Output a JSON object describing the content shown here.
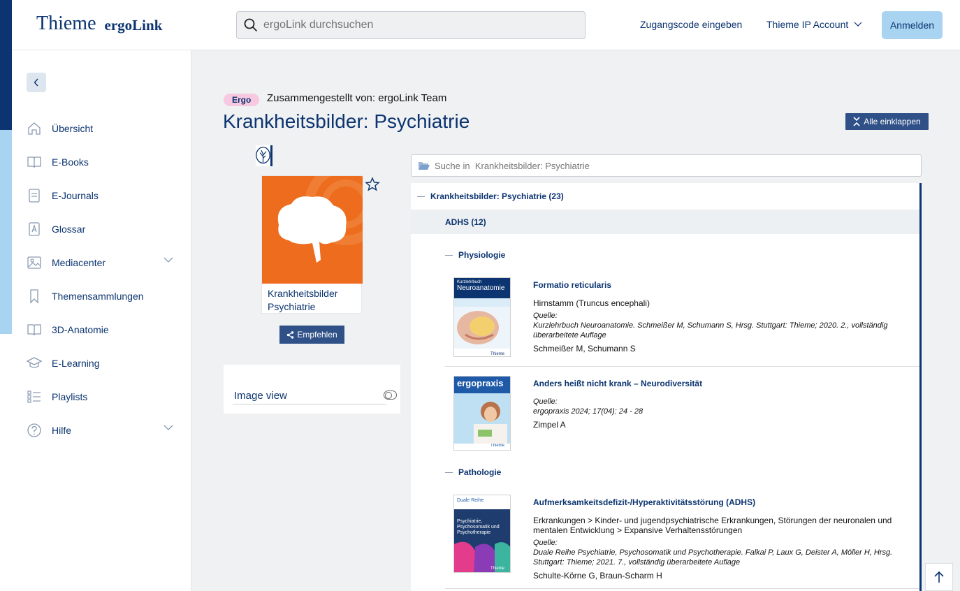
{
  "header": {
    "brand": "Thieme",
    "product": "ergoLink",
    "search_placeholder": "ergoLink durchsuchen",
    "access_code": "Zugangscode eingeben",
    "ip_account": "Thieme IP Account",
    "login": "Anmelden"
  },
  "sidebar": {
    "items": [
      {
        "label": "Übersicht",
        "icon": "home-icon"
      },
      {
        "label": "E-Books",
        "icon": "book-icon"
      },
      {
        "label": "E-Journals",
        "icon": "journal-icon"
      },
      {
        "label": "Glossar",
        "icon": "glossary-icon"
      },
      {
        "label": "Mediacenter",
        "icon": "image-icon",
        "expandable": true
      },
      {
        "label": "Themensammlungen",
        "icon": "bookmark-icon"
      },
      {
        "label": "3D-Anatomie",
        "icon": "book-icon"
      },
      {
        "label": "E-Learning",
        "icon": "graduation-cap-icon"
      },
      {
        "label": "Playlists",
        "icon": "list-icon"
      },
      {
        "label": "Hilfe",
        "icon": "help-icon",
        "expandable": true
      }
    ]
  },
  "page": {
    "badge": "Ergo",
    "compiled_by": "Zusammengestellt von: ergoLink Team",
    "title": "Krankheitsbilder: Psychiatrie",
    "collapse_all": "Alle einklappen",
    "cover_title_1": "Krankheitsbilder",
    "cover_title_2": "Psychiatrie",
    "share": "Empfehlen",
    "image_view": "Image view",
    "inner_search_placeholder": "Suche in  Krankheitsbilder: Psychiatrie"
  },
  "tree": {
    "root": "Krankheitsbilder: Psychiatrie (23)",
    "section": "ADHS (12)",
    "groups": [
      {
        "title": "Physiologie",
        "items": [
          {
            "title": "Formatio reticularis",
            "desc": "Hirnstamm (Truncus encephali)",
            "source_label": "Quelle:",
            "source": "Kurzlehrbuch Neuroanatomie. Schmeißer M, Schumann S, Hrsg. Stuttgart: Thieme; 2020. 2., vollständig überarbeitete Auflage",
            "authors": "Schmeißer M, Schumann S",
            "thumb_title": "Neuroanatomie",
            "thumb_series": "Kurzlehrbuch",
            "thumb_publisher": "Thieme"
          },
          {
            "title": "Anders heißt nicht krank – Neurodiversität",
            "source_label": "Quelle:",
            "source": "ergopraxis 2024; 17(04): 24 - 28",
            "authors": "Zimpel A",
            "thumb_title": "ergopraxis",
            "thumb_publisher": "Thieme"
          }
        ]
      },
      {
        "title": "Pathologie",
        "items": [
          {
            "title": "Aufmerksamkeitsdefizit-/Hyperaktivitätsstörung (ADHS)",
            "desc": "Erkrankungen > Kinder- und jugendpsychiatrische Erkrankungen, Störungen der neuronalen und mentalen Entwicklung > Expansive Verhaltensstörungen",
            "source_label": "Quelle:",
            "source": "Duale Reihe Psychiatrie, Psychosomatik und Psychotherapie. Falkai P, Laux G, Deister A, Möller H, Hrsg. Stuttgart: Thieme; 2021. 7., vollständig überarbeitete Auflage",
            "authors": "Schulte-Körne G, Braun-Scharm H",
            "thumb_series": "Duale Reihe",
            "thumb_title": "Psychiatrie, Psychosomatik und Psychotherapie",
            "thumb_publisher": "Thieme"
          }
        ]
      }
    ]
  },
  "colors": {
    "primary": "#0b3470",
    "accent_light": "#a8d4f2",
    "button": "#2f5188",
    "badge": "#f7c9e0",
    "cover_orange": "#ee6c1d"
  }
}
